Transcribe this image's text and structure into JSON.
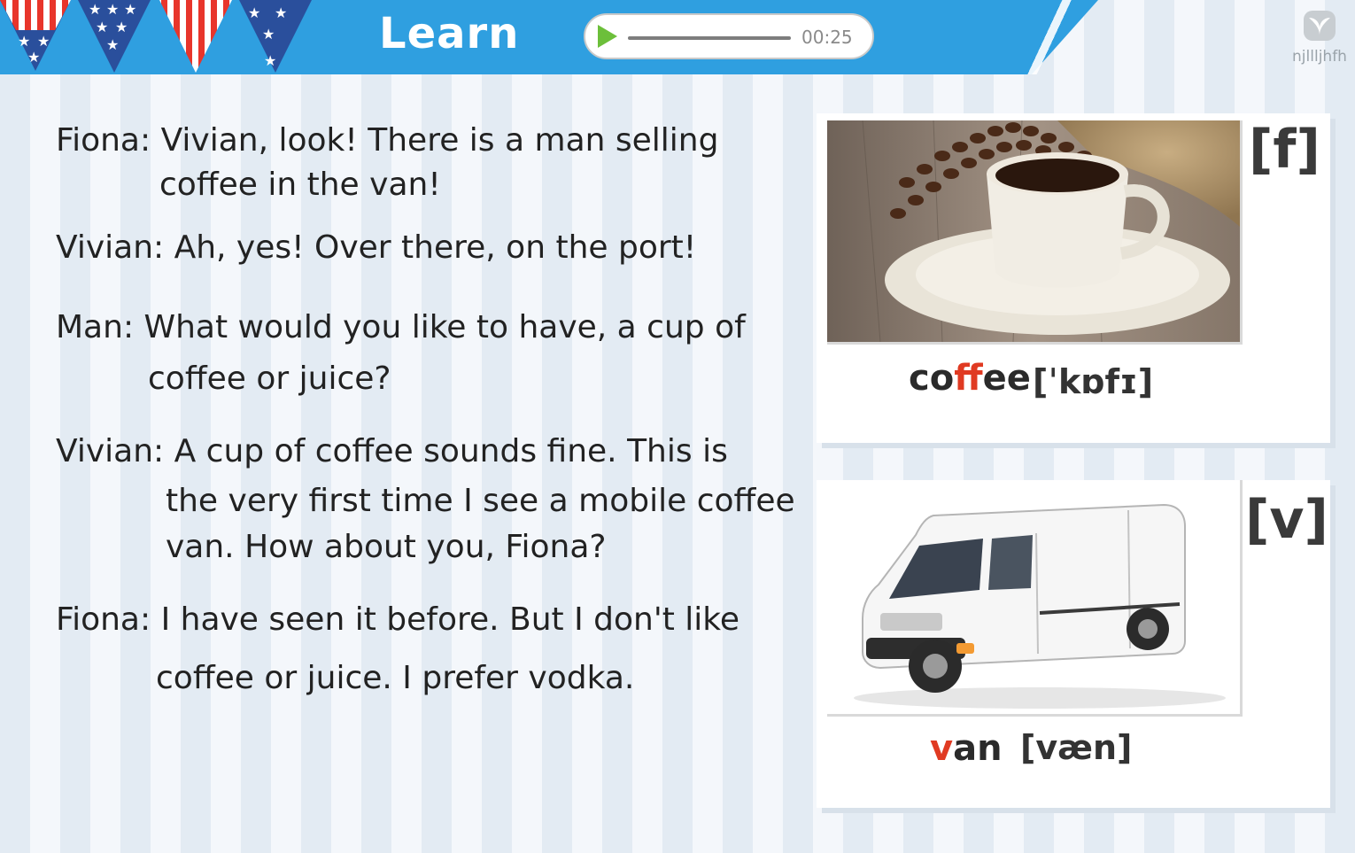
{
  "header": {
    "title": "Learn",
    "audio": {
      "time": "00:25",
      "progress": 0
    },
    "logo_text": "njllljhfh"
  },
  "dialogue": [
    {
      "text": "Fiona: Vivian, look! There is a man selling"
    },
    {
      "text": "coffee in the van!"
    },
    {
      "text": "Vivian: Ah, yes! Over there, on the port!"
    },
    {
      "text": "Man: What would you like to have, a cup of"
    },
    {
      "text": "coffee or juice?"
    },
    {
      "text": "Vivian: A cup of coffee sounds fine. This is"
    },
    {
      "text": "the very first time I see a mobile coffee"
    },
    {
      "text": "van. How about you, Fiona?"
    },
    {
      "text": "Fiona: I have seen it before. But I don't like"
    },
    {
      "text": "coffee or juice. I prefer vodka."
    }
  ],
  "cards": [
    {
      "sound": "[f]",
      "word_parts": [
        "co",
        "ff",
        "ee"
      ],
      "phonetic": "[ˈkɒfɪ]",
      "image": "coffee-cup-photo"
    },
    {
      "sound": "[v]",
      "word_parts": [
        "",
        "v",
        "an"
      ],
      "phonetic": "[væn]",
      "image": "white-van-photo"
    }
  ],
  "colors": {
    "header_blue": "#2f9fe0",
    "highlight_red": "#e03a22",
    "play_green": "#6cbf3a"
  }
}
